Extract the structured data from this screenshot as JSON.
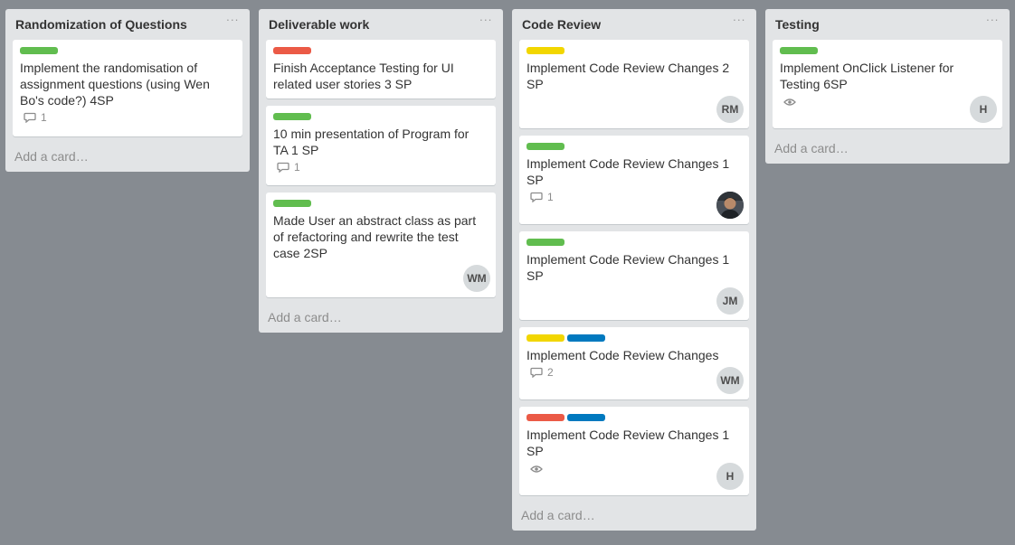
{
  "colors": {
    "green": "#61bd4f",
    "red": "#eb5a46",
    "yellow": "#f2d600",
    "blue": "#0079bf"
  },
  "lists": [
    {
      "title": "Randomization of Questions",
      "menu": "···",
      "add_card": "Add a card…",
      "cards": [
        {
          "labels": [
            "green"
          ],
          "title": "Implement the randomisation of assignment questions (using Wen Bo's code?) 4SP",
          "comments": "1"
        }
      ]
    },
    {
      "title": "Deliverable work",
      "menu": "···",
      "add_card": "Add a card…",
      "cards": [
        {
          "labels": [
            "red"
          ],
          "title": "Finish Acceptance Testing for UI related user stories 3 SP"
        },
        {
          "labels": [
            "green"
          ],
          "title": "10 min presentation of Program for TA 1 SP",
          "comments": "1"
        },
        {
          "labels": [
            "green"
          ],
          "title": "Made User an abstract class as part of refactoring and rewrite the test case 2SP",
          "avatar": "WM"
        }
      ]
    },
    {
      "title": "Code Review",
      "menu": "···",
      "add_card": "Add a card…",
      "cards": [
        {
          "labels": [
            "yellow"
          ],
          "title": "Implement Code Review Changes 2 SP",
          "avatar": "RM"
        },
        {
          "labels": [
            "green"
          ],
          "title": "Implement Code Review Changes 1 SP",
          "comments": "1",
          "avatar_photo": true
        },
        {
          "labels": [
            "green"
          ],
          "title": "Implement Code Review Changes 1 SP",
          "avatar": "JM"
        },
        {
          "labels": [
            "yellow",
            "blue"
          ],
          "title": "Implement Code Review Changes",
          "comments": "2",
          "avatar": "WM"
        },
        {
          "labels": [
            "red",
            "blue"
          ],
          "title": "Implement Code Review Changes 1 SP",
          "watching": true,
          "avatar": "H"
        }
      ]
    },
    {
      "title": "Testing",
      "menu": "···",
      "add_card": "Add a card…",
      "cards": [
        {
          "labels": [
            "green"
          ],
          "title": "Implement OnClick Listener for Testing 6SP",
          "watching": true,
          "avatar": "H"
        }
      ]
    }
  ]
}
